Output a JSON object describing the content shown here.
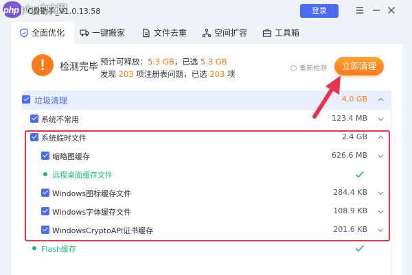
{
  "window": {
    "title": "C盘助手_V1.0.13.58",
    "watermark": "php中文网",
    "login_label": "登录"
  },
  "tabs": [
    {
      "label": "全面优化",
      "icon": "shield-icon",
      "active": true
    },
    {
      "label": "一键搬家",
      "icon": "truck-icon",
      "active": false
    },
    {
      "label": "文件去重",
      "icon": "file-icon",
      "active": false
    },
    {
      "label": "空间扩容",
      "icon": "expand-icon",
      "active": false
    },
    {
      "label": "工具箱",
      "icon": "toolbox-icon",
      "active": false
    }
  ],
  "summary": {
    "status": "检测完毕",
    "line1_prefix": "预计可释放：",
    "line1_value": "5.3 GB",
    "line1_mid": "，已选",
    "line1_selected": "5.3 GB",
    "line2_prefix": "发现",
    "line2_count": "203",
    "line2_mid": "项注册表问题，已选",
    "line2_selected": "203",
    "line2_suffix": "项",
    "rescan_label": "重新检测",
    "clean_label": "立即清理"
  },
  "items": [
    {
      "label": "垃圾清理",
      "size": "4.0 GB",
      "type": "category",
      "checked": true
    },
    {
      "label": "系统不常用",
      "size": "123.4 MB",
      "type": "group",
      "checked": true
    },
    {
      "label": "系统临时文件",
      "size": "2.4 GB",
      "type": "group",
      "checked": true,
      "expanded": true
    },
    {
      "label": "缩略图缓存",
      "size": "626.6 MB",
      "type": "child",
      "checked": true
    },
    {
      "label": "远程桌面缓存文件",
      "size": "",
      "type": "child-done"
    },
    {
      "label": "Windows图标缓存文件",
      "size": "284.4 KB",
      "type": "child",
      "checked": true
    },
    {
      "label": "Windows字体缓存文件",
      "size": "108.9 KB",
      "type": "child",
      "checked": true
    },
    {
      "label": "WindowsCryptoAPI证书缓存",
      "size": "201.6 KB",
      "type": "child",
      "checked": true
    },
    {
      "label": "Flash缓存",
      "size": "",
      "type": "group-done"
    }
  ],
  "colors": {
    "accent_blue": "#4a6cf7",
    "accent_orange": "#ff7a1a",
    "success_green": "#22b573",
    "highlight_red": "#e8344a"
  }
}
